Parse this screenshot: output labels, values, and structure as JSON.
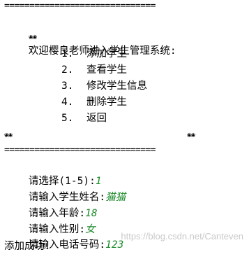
{
  "console": {
    "rule_top": "==============================",
    "welcome_flowers": "❀❀",
    "welcome_text": "欢迎樱良老师进入学生管理系统:",
    "menu": [
      {
        "num": "1.",
        "label": "添加学生"
      },
      {
        "num": "2.",
        "label": "查看学生"
      },
      {
        "num": "3.",
        "label": "修改学生信息"
      },
      {
        "num": "4.",
        "label": "删除学生"
      },
      {
        "num": "5.",
        "label": "返回"
      }
    ],
    "footer_flowers_left": "❀❀",
    "footer_flowers_right": "❀❀",
    "rule_bottom": "==============================",
    "prompts": [
      {
        "label": "请选择(1-5):",
        "value": "1"
      },
      {
        "label": "请输入学生姓名:",
        "value": "猫猫"
      },
      {
        "label": "请输入年龄:",
        "value": "18"
      },
      {
        "label": "请输入性别:",
        "value": "女"
      },
      {
        "label": "请输入电话号码:",
        "value": "123"
      }
    ],
    "result": "添加成功!"
  },
  "watermark": "https://blog.csdn.net/Canteven",
  "colors": {
    "background": "#ffffff",
    "text": "#000000",
    "input_value": "#1a8a2a",
    "watermark": "#c9c9c9"
  }
}
